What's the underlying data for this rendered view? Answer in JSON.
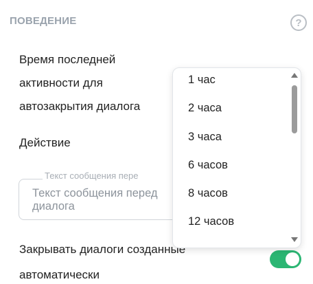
{
  "section": {
    "title": "ПОВЕДЕНИЕ"
  },
  "help_icon": "question-circle-icon",
  "inactivity": {
    "label_lines": [
      "Время последней",
      "активности для",
      "автозакрытия диалога"
    ]
  },
  "action": {
    "label": "Действие"
  },
  "message": {
    "floating_label": "Текст сообщения пере",
    "placeholder_lines": [
      "Текст сообщения перед",
      "диалога"
    ]
  },
  "auto_close": {
    "label_lines": [
      "Закрывать диалоги созданные",
      "автоматически"
    ],
    "toggle_on": true,
    "toggle_color": "#2bb673"
  },
  "dropdown": {
    "options": [
      "1 час",
      "2 часа",
      "3 часа",
      "6 часов",
      "8 часов",
      "12 часов"
    ]
  }
}
